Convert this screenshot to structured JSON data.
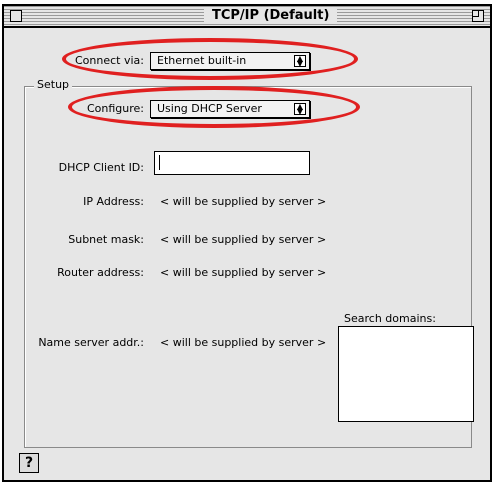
{
  "window": {
    "title": "TCP/IP (Default)"
  },
  "connect_via": {
    "label": "Connect via:",
    "value": "Ethernet built-in"
  },
  "setup": {
    "group_title": "Setup",
    "configure": {
      "label": "Configure:",
      "value": "Using DHCP Server"
    },
    "dhcp_client_id": {
      "label": "DHCP Client ID:",
      "value": ""
    },
    "ip_address": {
      "label": "IP Address:",
      "value": "< will be supplied by server >"
    },
    "subnet_mask": {
      "label": "Subnet mask:",
      "value": "< will be supplied by server >"
    },
    "router_address": {
      "label": "Router address:",
      "value": "< will be supplied by server >"
    },
    "name_server": {
      "label": "Name server addr.:",
      "value": "< will be supplied by server >"
    },
    "search_domains": {
      "label": "Search domains:",
      "value": ""
    }
  },
  "icons": {
    "close": "close-box-icon",
    "zoom": "zoom-box-icon",
    "help": "help-icon",
    "popup_arrow": "up-down-arrows-icon"
  },
  "colors": {
    "annotation": "#e02020",
    "window_bg": "#e6e6e6"
  }
}
